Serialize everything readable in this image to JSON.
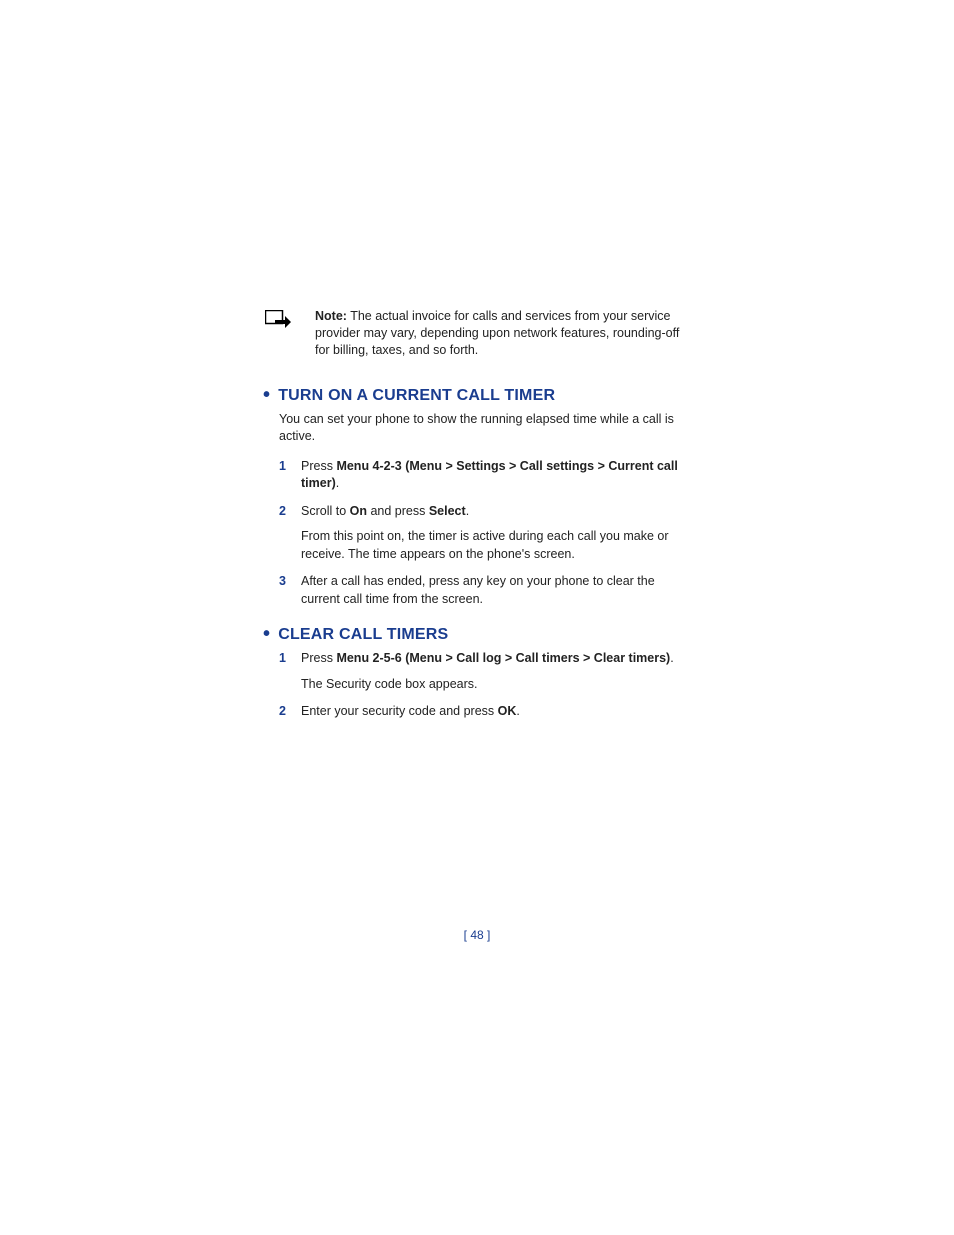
{
  "note": {
    "label": "Note:",
    "text": "The actual invoice for calls and services from your service provider may vary, depending upon network features, rounding-off for billing, taxes, and so forth."
  },
  "section1": {
    "heading": "TURN ON A CURRENT CALL TIMER",
    "intro": "You can set your phone to show the running elapsed time while a call is active.",
    "steps": {
      "s1": {
        "num": "1",
        "pre": "Press ",
        "bold": "Menu 4-2-3 (Menu > Settings > Call settings > Current call timer)",
        "post": "."
      },
      "s2": {
        "num": "2",
        "a": "Scroll to ",
        "b1": "On",
        "c": " and press ",
        "b2": "Select",
        "d": ".",
        "follow": "From this point on, the timer is active during each call you make or receive. The time appears on the phone's screen."
      },
      "s3": {
        "num": "3",
        "text": "After a call has ended, press any key on your phone to clear the current call time from the screen."
      }
    }
  },
  "section2": {
    "heading": "CLEAR CALL TIMERS",
    "steps": {
      "s1": {
        "num": "1",
        "pre": "Press ",
        "bold": "Menu 2-5-6 (Menu > Call log > Call timers > Clear timers)",
        "post": ".",
        "follow": "The Security code box appears."
      },
      "s2": {
        "num": "2",
        "a": "Enter your security code and press ",
        "b": "OK",
        "c": "."
      }
    }
  },
  "footer": "[ 48 ]"
}
